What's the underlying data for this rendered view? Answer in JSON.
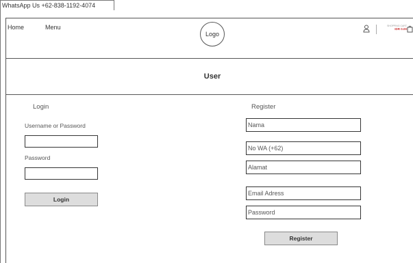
{
  "topbar": {
    "whatsapp": "WhatsApp Us +62-838-1192-4074"
  },
  "nav": {
    "home": "Home",
    "menu": "Menu",
    "logo": "Logo"
  },
  "cart": {
    "label": "SHOPPING CART",
    "amount": "IDR 0.00"
  },
  "page": {
    "title": "User"
  },
  "login": {
    "heading": "Login",
    "username_label": "Username or Password",
    "password_label": "Password",
    "button": "Login"
  },
  "register": {
    "heading": "Register",
    "fields": [
      "Nama",
      "No WA (+62)",
      "Alamat",
      "Email Adress",
      "Password"
    ],
    "button": "Register"
  }
}
